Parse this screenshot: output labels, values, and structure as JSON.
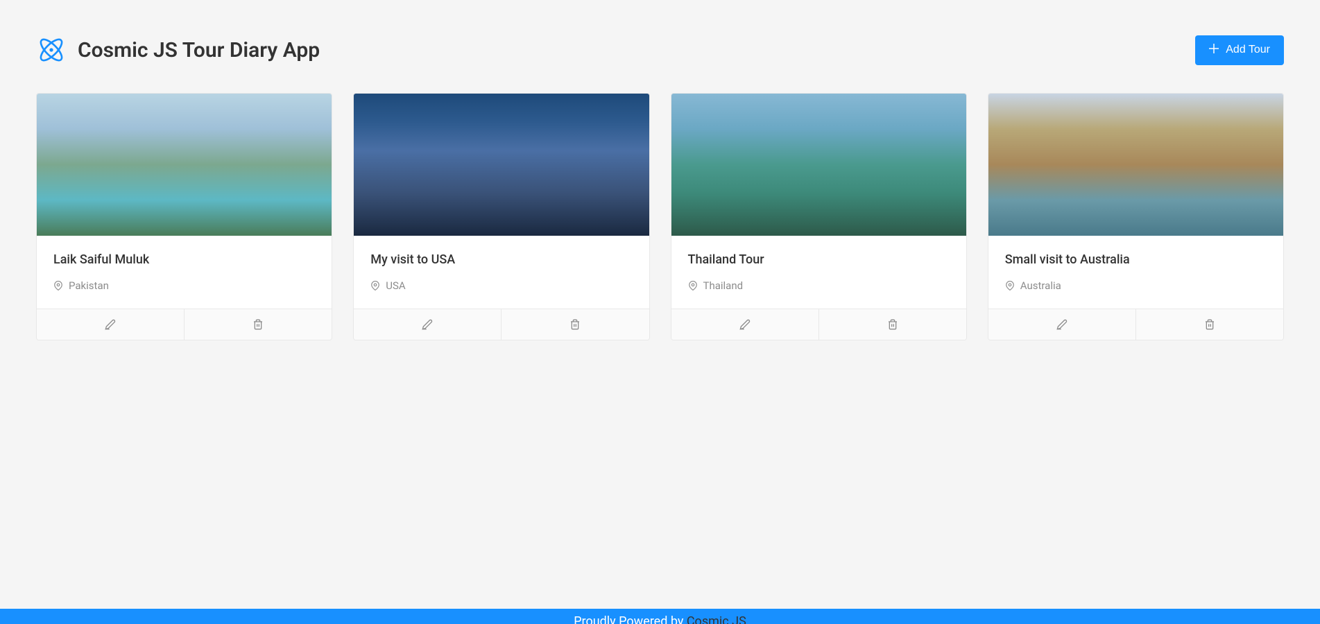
{
  "header": {
    "title": "Cosmic JS Tour Diary App",
    "add_button_label": "Add Tour"
  },
  "tours": [
    {
      "title": "Laik Saiful Muluk",
      "location": "Pakistan",
      "image_class": "img-pakistan"
    },
    {
      "title": "My visit to USA",
      "location": "USA",
      "image_class": "img-usa"
    },
    {
      "title": "Thailand Tour",
      "location": "Thailand",
      "image_class": "img-thailand"
    },
    {
      "title": "Small visit to Australia",
      "location": "Australia",
      "image_class": "img-australia"
    }
  ],
  "footer": {
    "text": "Proudly Powered by ",
    "link_text": "Cosmic JS"
  }
}
